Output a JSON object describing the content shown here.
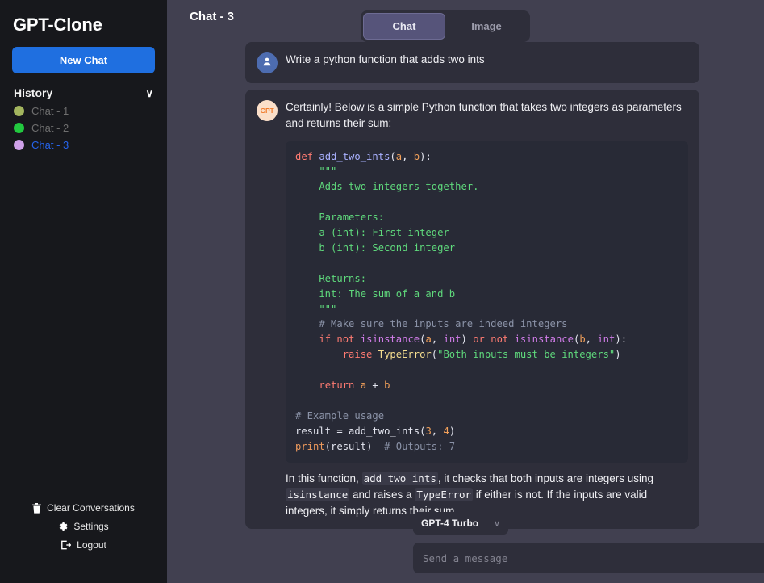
{
  "sidebar": {
    "brand": "GPT-Clone",
    "new_chat_label": "New Chat",
    "history_title": "History",
    "history_chevron": "∨",
    "history": [
      {
        "label": "Chat - 1",
        "dot_color": "#a3b55e",
        "active": false
      },
      {
        "label": "Chat - 2",
        "dot_color": "#22c93f",
        "active": false
      },
      {
        "label": "Chat - 3",
        "dot_color": "#cfa0e8",
        "active": true
      }
    ],
    "footer": [
      {
        "label": "Clear Conversations",
        "icon": "trash-icon"
      },
      {
        "label": "Settings",
        "icon": "gear-icon"
      },
      {
        "label": "Logout",
        "icon": "logout-icon"
      }
    ]
  },
  "header": {
    "chat_title": "Chat - 3",
    "tabs": [
      {
        "label": "Chat",
        "active": true
      },
      {
        "label": "Image",
        "active": false
      }
    ]
  },
  "thread": {
    "user_message": {
      "avatar_label": "",
      "text": "Write a python function that adds two ints"
    },
    "assistant_message": {
      "avatar_label": "GPT",
      "intro": "Certainly! Below is a simple Python function that takes two integers as parameters and returns their sum:",
      "code_lines": [
        [
          {
            "t": "def ",
            "c": "k"
          },
          {
            "t": "add_two_ints",
            "c": "fn"
          },
          {
            "t": "(",
            "c": "op"
          },
          {
            "t": "a",
            "c": "pm"
          },
          {
            "t": ", ",
            "c": "op"
          },
          {
            "t": "b",
            "c": "pm"
          },
          {
            "t": "):",
            "c": "op"
          }
        ],
        [
          {
            "t": "    \"\"\"",
            "c": "st"
          }
        ],
        [
          {
            "t": "    Adds two integers together.",
            "c": "st"
          }
        ],
        [
          {
            "t": "",
            "c": "st"
          }
        ],
        [
          {
            "t": "    Parameters:",
            "c": "st"
          }
        ],
        [
          {
            "t": "    a (int): First integer",
            "c": "st"
          }
        ],
        [
          {
            "t": "    b (int): Second integer",
            "c": "st"
          }
        ],
        [
          {
            "t": "",
            "c": "st"
          }
        ],
        [
          {
            "t": "    Returns:",
            "c": "st"
          }
        ],
        [
          {
            "t": "    int: The sum of a and b",
            "c": "st"
          }
        ],
        [
          {
            "t": "    \"\"\"",
            "c": "st"
          }
        ],
        [
          {
            "t": "    # Make sure the inputs are indeed integers",
            "c": "cm"
          }
        ],
        [
          {
            "t": "    ",
            "c": "op"
          },
          {
            "t": "if",
            "c": "k"
          },
          {
            "t": " ",
            "c": "op"
          },
          {
            "t": "not",
            "c": "k"
          },
          {
            "t": " ",
            "c": "op"
          },
          {
            "t": "isinstance",
            "c": "bi"
          },
          {
            "t": "(",
            "c": "op"
          },
          {
            "t": "a",
            "c": "pm"
          },
          {
            "t": ", ",
            "c": "op"
          },
          {
            "t": "int",
            "c": "bi"
          },
          {
            "t": ") ",
            "c": "op"
          },
          {
            "t": "or",
            "c": "k"
          },
          {
            "t": " ",
            "c": "op"
          },
          {
            "t": "not",
            "c": "k"
          },
          {
            "t": " ",
            "c": "op"
          },
          {
            "t": "isinstance",
            "c": "bi"
          },
          {
            "t": "(",
            "c": "op"
          },
          {
            "t": "b",
            "c": "pm"
          },
          {
            "t": ", ",
            "c": "op"
          },
          {
            "t": "int",
            "c": "bi"
          },
          {
            "t": "):",
            "c": "op"
          }
        ],
        [
          {
            "t": "        ",
            "c": "op"
          },
          {
            "t": "raise",
            "c": "k"
          },
          {
            "t": " ",
            "c": "op"
          },
          {
            "t": "TypeError",
            "c": "ex"
          },
          {
            "t": "(",
            "c": "op"
          },
          {
            "t": "\"Both inputs must be integers\"",
            "c": "st"
          },
          {
            "t": ")",
            "c": "op"
          }
        ],
        [
          {
            "t": "",
            "c": "op"
          }
        ],
        [
          {
            "t": "    ",
            "c": "op"
          },
          {
            "t": "return",
            "c": "k"
          },
          {
            "t": " ",
            "c": "op"
          },
          {
            "t": "a",
            "c": "pm"
          },
          {
            "t": " + ",
            "c": "op"
          },
          {
            "t": "b",
            "c": "pm"
          }
        ],
        [
          {
            "t": "",
            "c": "op"
          }
        ],
        [
          {
            "t": "# Example usage",
            "c": "cm"
          }
        ],
        [
          {
            "t": "result",
            "c": "id"
          },
          {
            "t": " = ",
            "c": "op"
          },
          {
            "t": "add_two_ints",
            "c": "id"
          },
          {
            "t": "(",
            "c": "op"
          },
          {
            "t": "3",
            "c": "pm"
          },
          {
            "t": ", ",
            "c": "op"
          },
          {
            "t": "4",
            "c": "pm"
          },
          {
            "t": ")",
            "c": "op"
          }
        ],
        [
          {
            "t": "print",
            "c": "pn"
          },
          {
            "t": "(",
            "c": "op"
          },
          {
            "t": "result",
            "c": "id"
          },
          {
            "t": ")  ",
            "c": "op"
          },
          {
            "t": "# Outputs: 7",
            "c": "cm"
          }
        ]
      ],
      "outro_parts": [
        {
          "t": "In this function, ",
          "code": false
        },
        {
          "t": "add_two_ints",
          "code": true
        },
        {
          "t": ", it checks that both inputs are integers using ",
          "code": false
        },
        {
          "t": "isinstance",
          "code": true
        },
        {
          "t": " and raises a ",
          "code": false
        },
        {
          "t": "TypeError",
          "code": true
        },
        {
          "t": " if either is not. If the inputs are valid integers, it simply returns their sum.",
          "code": false
        }
      ]
    }
  },
  "composer": {
    "model_label": "GPT-4 Turbo",
    "model_caret": "∨",
    "model_options": [
      "GPT-4 Turbo"
    ],
    "input_value": "",
    "input_placeholder": "Send a message",
    "send_icon": "send-paper-plane-icon"
  },
  "colors": {
    "sidebar_bg": "#17181c",
    "main_bg": "#414050",
    "panel_bg": "#2e2e3a",
    "code_bg": "#282a36",
    "accent_blue": "#1f6fe0",
    "active_link": "#2563eb",
    "tab_active_bg": "#56547a"
  }
}
